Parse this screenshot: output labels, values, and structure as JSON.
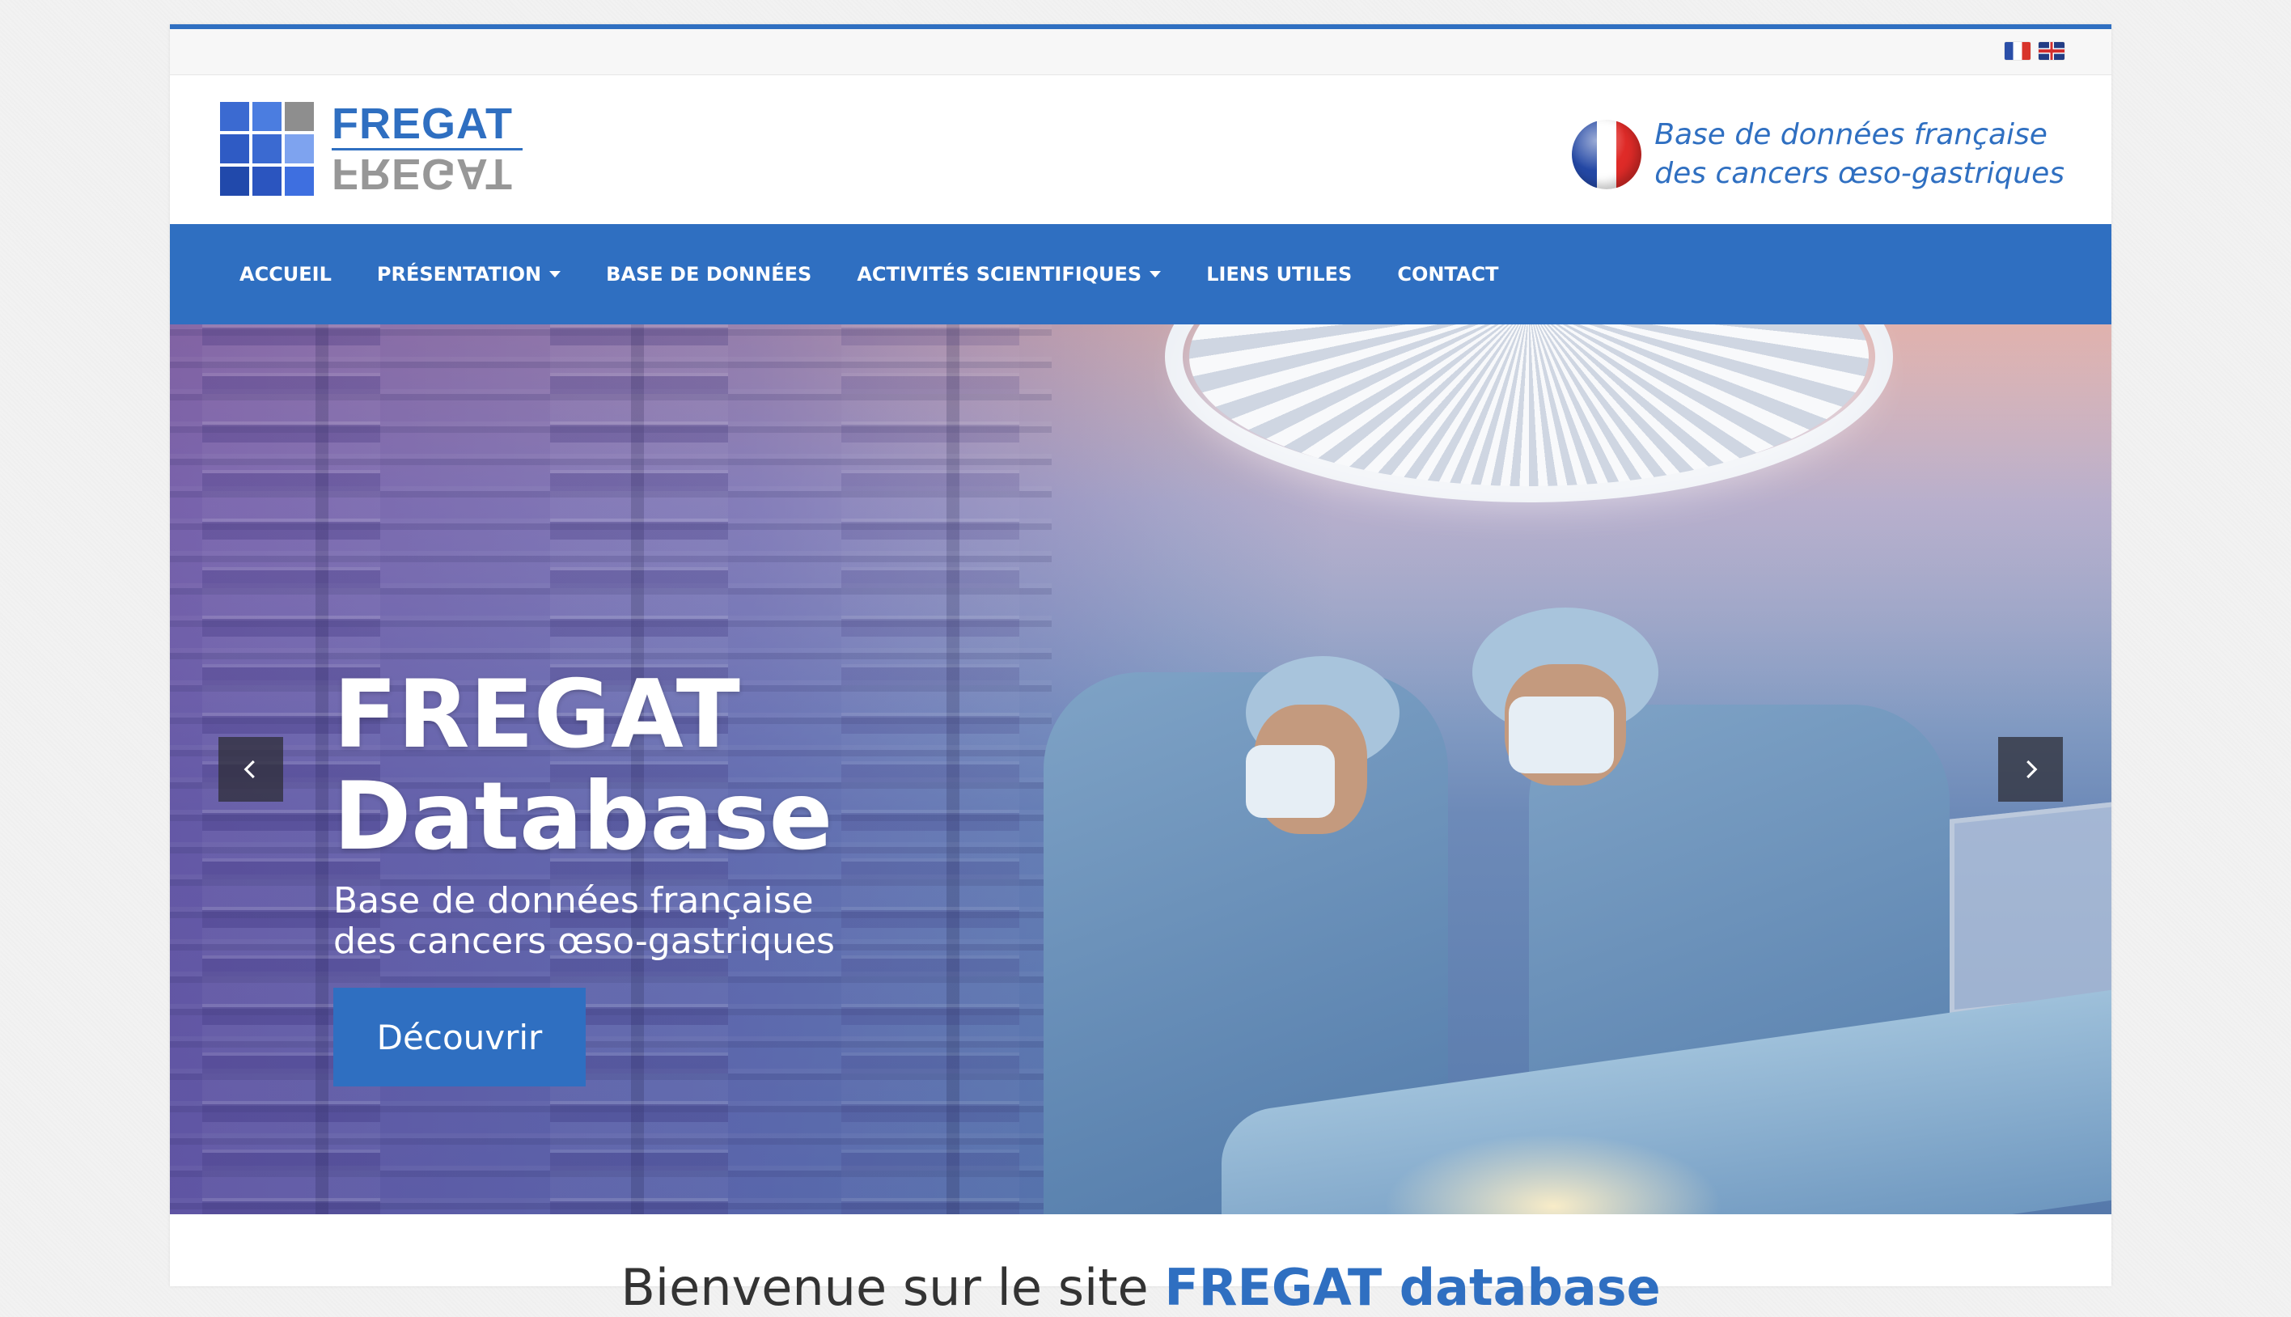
{
  "languages": [
    {
      "code": "fr",
      "icon": "french-flag-icon"
    },
    {
      "code": "en",
      "icon": "british-flag-icon"
    }
  ],
  "header": {
    "logo_text": "FREGAT",
    "logo_mirror_text": "FREGAT",
    "tagline_line1": "Base de données française",
    "tagline_line2": "des cancers œso-gastriques"
  },
  "nav": {
    "items": [
      {
        "label": "ACCUEIL",
        "dropdown": false
      },
      {
        "label": "PRÉSENTATION",
        "dropdown": true
      },
      {
        "label": "BASE DE DONNÉES",
        "dropdown": false
      },
      {
        "label": "ACTIVITÉS SCIENTIFIQUES",
        "dropdown": true
      },
      {
        "label": "LIENS UTILES",
        "dropdown": false
      },
      {
        "label": "CONTACT",
        "dropdown": false
      }
    ]
  },
  "hero": {
    "title_line1": "FREGAT",
    "title_line2": "Database",
    "subtitle_line1": "Base de données française",
    "subtitle_line2": "des cancers œso-gastriques",
    "button_label": "Découvrir"
  },
  "welcome": {
    "text_prefix": "Bienvenue sur le site",
    "text_highlight": "FREGAT database"
  },
  "colors": {
    "brand_blue": "#2f6fc1",
    "nav_text": "#ffffff",
    "logo_grey": "#8c8c8c"
  }
}
